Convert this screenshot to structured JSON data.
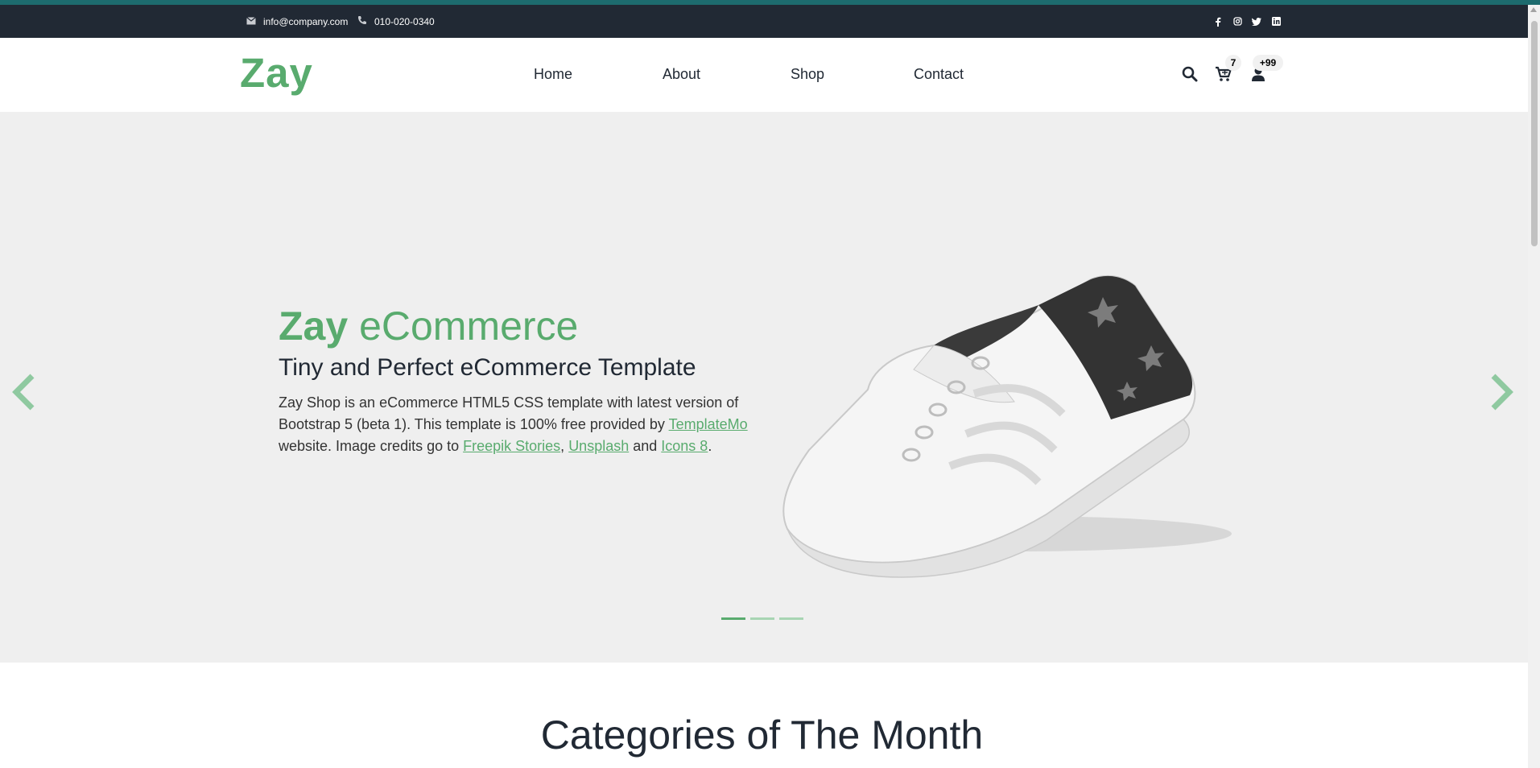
{
  "topbar": {
    "email": "info@company.com",
    "phone": "010-020-0340",
    "social_icons": [
      "facebook-icon",
      "instagram-icon",
      "twitter-icon",
      "linkedin-icon"
    ]
  },
  "nav": {
    "logo": "Zay",
    "menu": [
      "Home",
      "About",
      "Shop",
      "Contact"
    ],
    "cart_count": "7",
    "user_count": "+99"
  },
  "hero": {
    "title_bold": "Zay",
    "title_light": " eCommerce",
    "subtitle": "Tiny and Perfect eCommerce Template",
    "desc_1": "Zay Shop is an eCommerce HTML5 CSS template with latest version of Bootstrap 5 (beta 1). This template is 100% free provided by ",
    "link_templatemo": "TemplateMo",
    "desc_2": " website. Image credits go to ",
    "link_freepik": "Freepik Stories",
    "desc_comma": ", ",
    "link_unsplash": "Unsplash",
    "desc_and": " and ",
    "link_icons8": "Icons 8",
    "desc_end": ".",
    "slide_count": 3,
    "active_slide": 1
  },
  "categories": {
    "title": "Categories of The Month"
  },
  "colors": {
    "brand": "#59ab6e",
    "topbar": "#212934",
    "hero_bg": "#efefef"
  }
}
